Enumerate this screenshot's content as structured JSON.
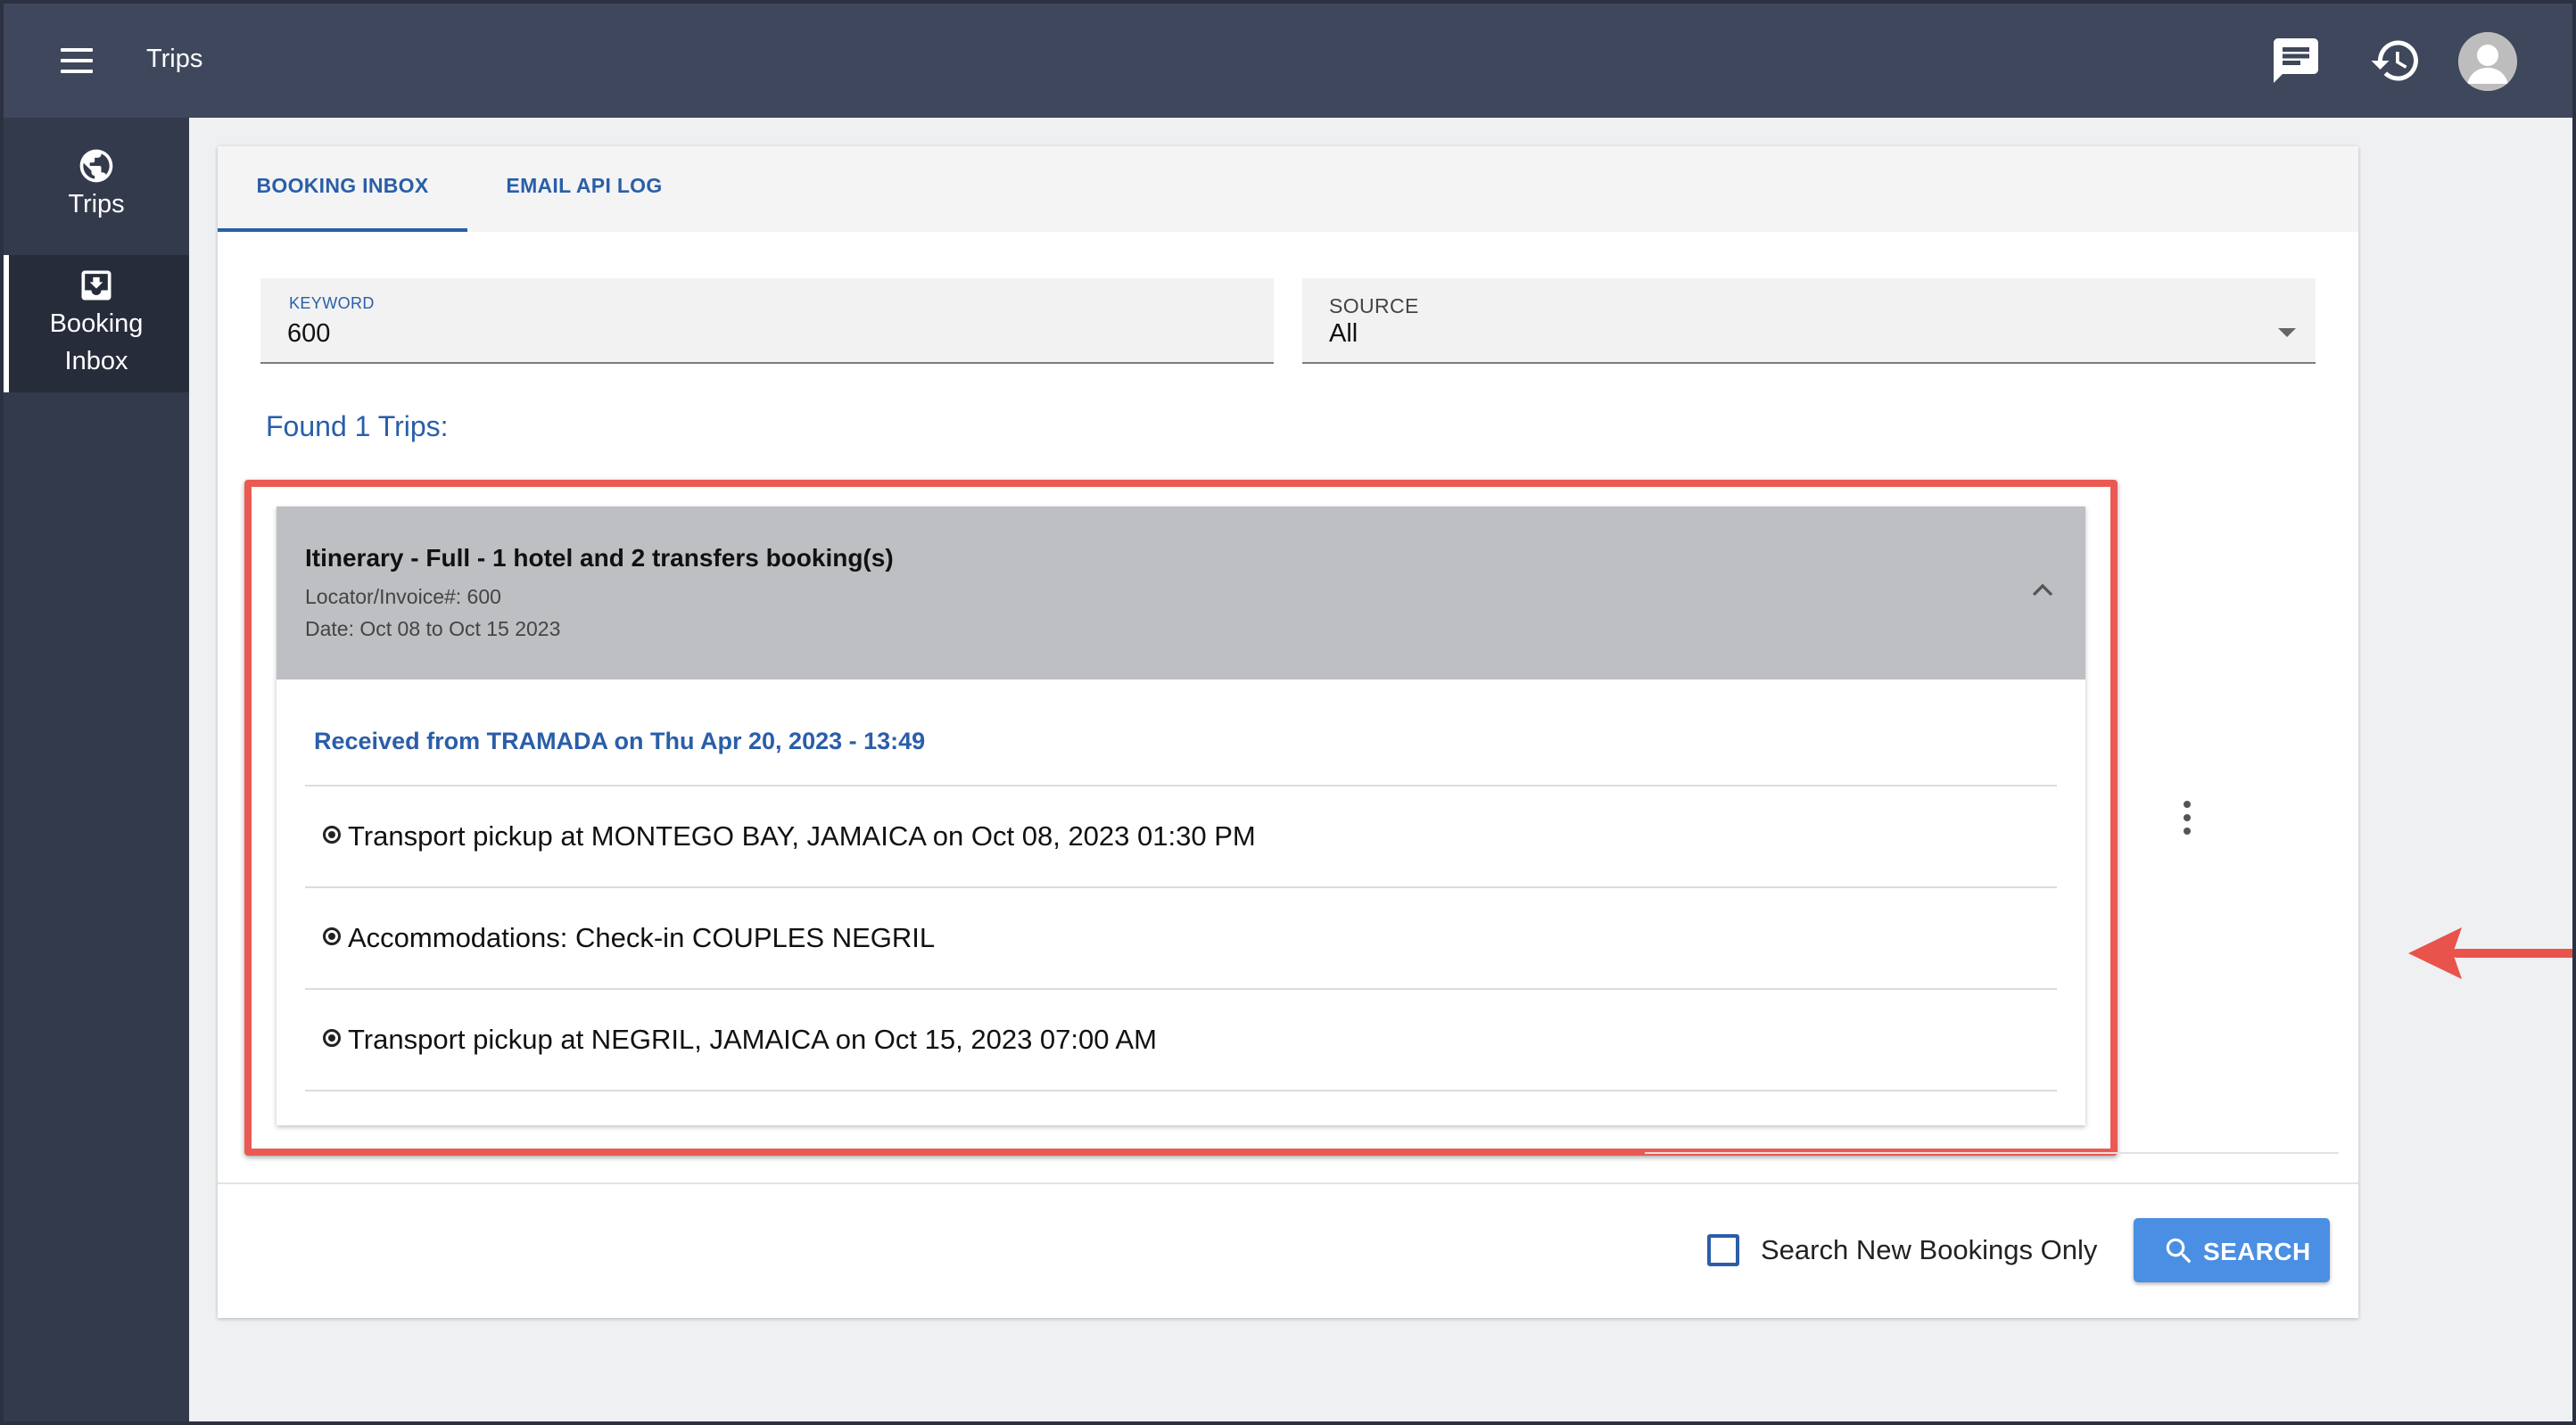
{
  "appbar": {
    "title": "Trips",
    "icons": [
      "menu-icon",
      "chat-icon",
      "history-icon",
      "avatar"
    ]
  },
  "sidenav": {
    "items": [
      {
        "label": "Trips",
        "icon": "globe-icon"
      },
      {
        "label_line1": "Booking",
        "label_line2": "Inbox",
        "icon": "inbox-download-icon",
        "active": true
      }
    ]
  },
  "tabs": [
    {
      "label": "BOOKING INBOX",
      "active": true
    },
    {
      "label": "EMAIL API LOG",
      "active": false
    }
  ],
  "filters": {
    "keyword": {
      "label": "KEYWORD",
      "value": "600"
    },
    "source": {
      "label": "SOURCE",
      "value": "All"
    }
  },
  "results": {
    "found_text": "Found 1 Trips:"
  },
  "trip": {
    "title": "Itinerary - Full - 1 hotel and 2 transfers booking(s)",
    "locator": "Locator/Invoice#: 600",
    "date": "Date: Oct 08 to Oct 15 2023",
    "received": "Received from TRAMADA on Thu Apr 20, 2023 - 13:49",
    "items": [
      "Transport pickup at MONTEGO BAY, JAMAICA on Oct 08, 2023 01:30 PM",
      "Accommodations: Check-in COUPLES NEGRIL",
      "Transport pickup at NEGRIL, JAMAICA on Oct 15, 2023 07:00 AM"
    ]
  },
  "footer": {
    "checkbox_label": "Search New Bookings Only",
    "checkbox_checked": false,
    "search_label": "SEARCH"
  },
  "colors": {
    "appbar": "#3e475b",
    "sidenav": "#323a4b",
    "accent": "#2a5ea8",
    "button": "#4a8fe3",
    "highlight": "#eb5a52"
  }
}
